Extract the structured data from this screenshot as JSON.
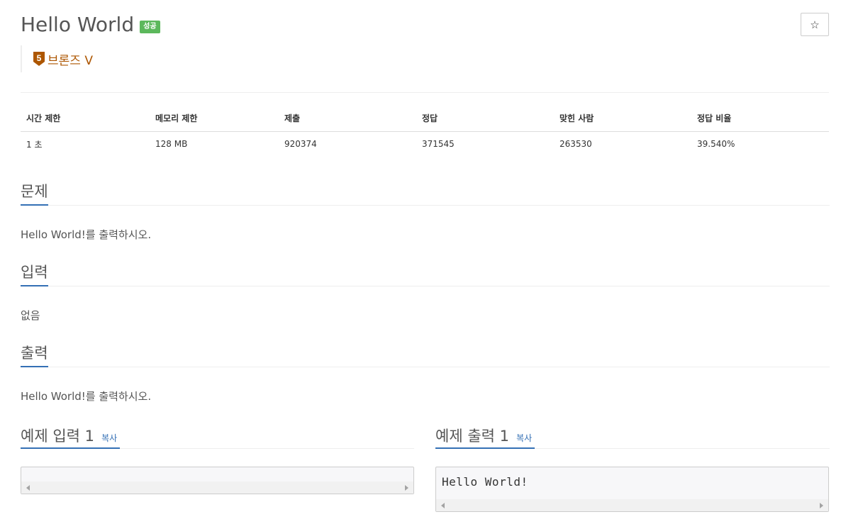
{
  "problem": {
    "title": "Hello World",
    "result_badge": "성공",
    "star_label": "☆",
    "tier": {
      "number": "5",
      "label": "브론즈 V",
      "color": "#ad5600"
    }
  },
  "stats": {
    "headers": [
      "시간 제한",
      "메모리 제한",
      "제출",
      "정답",
      "맞힌 사람",
      "정답 비율"
    ],
    "values": [
      "1 초",
      "128 MB",
      "920374",
      "371545",
      "263530",
      "39.540%"
    ]
  },
  "sections": {
    "problem": {
      "heading": "문제",
      "text": "Hello World!를 출력하시오."
    },
    "input": {
      "heading": "입력",
      "text": "없음"
    },
    "output": {
      "heading": "출력",
      "text": "Hello World!를 출력하시오."
    }
  },
  "samples": {
    "input": {
      "heading": "예제 입력 1",
      "copy_label": "복사",
      "content": ""
    },
    "output": {
      "heading": "예제 출력 1",
      "copy_label": "복사",
      "content": "Hello World!"
    }
  },
  "colors": {
    "accent": "#3470b5",
    "success": "#5cb85c"
  }
}
